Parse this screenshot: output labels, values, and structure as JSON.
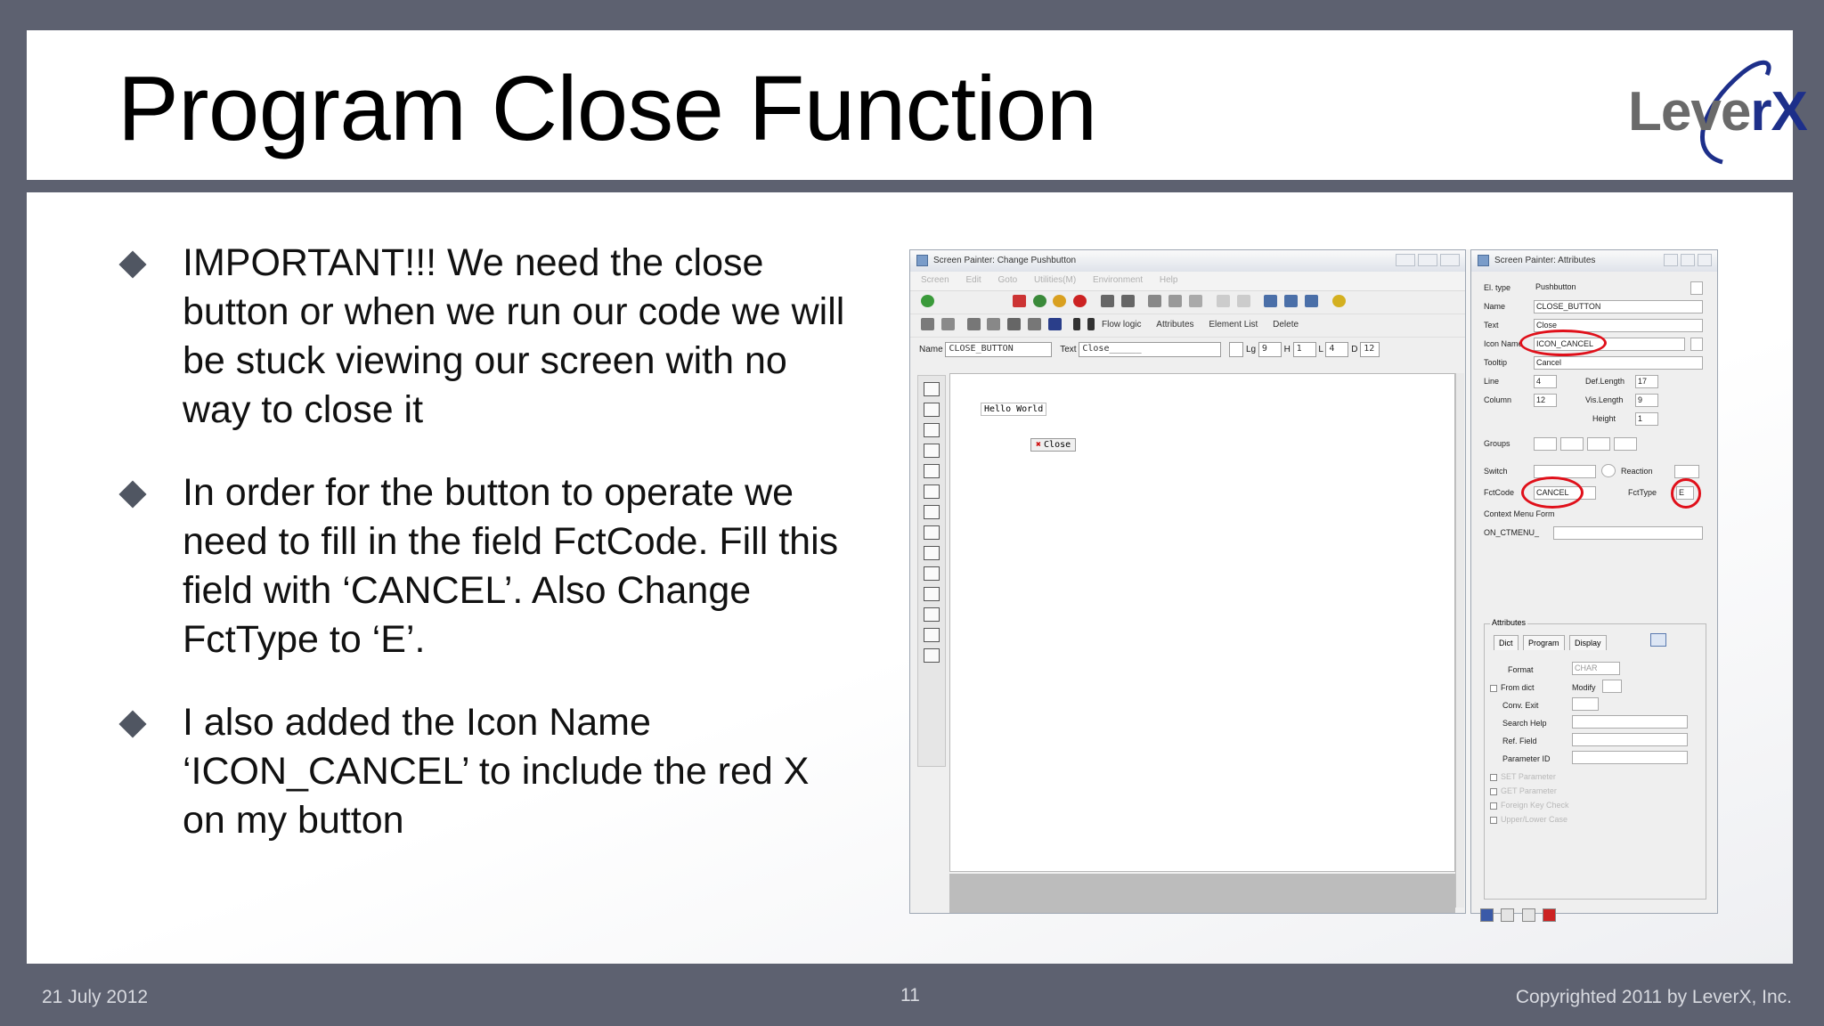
{
  "slide": {
    "title": "Program Close Function",
    "logo": {
      "text_main": "Leve",
      "text_accent": "rX",
      "accent_color": "#1d2f8a"
    },
    "bullets": [
      {
        "text": "IMPORTANT!!! We need the close button or when we run our code we will be stuck viewing our screen with no way to close it"
      },
      {
        "text": "In order for the button to operate we need to fill in the field FctCode. Fill this field with ‘CANCEL’. Also Change FctType to ‘E’."
      },
      {
        "text": "I also added the Icon Name ‘ICON_CANCEL’ to include the red X on my button"
      }
    ],
    "footer": {
      "date": "21 July 2012",
      "page": "11",
      "copyright": "Copyrighted 2011 by LeverX, Inc."
    }
  },
  "screenshot": {
    "left_window": {
      "title": "Screen Painter: Change Pushbutton",
      "menu": [
        "Screen",
        "Edit",
        "Goto",
        "Utilities(M)",
        "Environment",
        "Help"
      ],
      "toolbar_labels": [
        "Flow logic",
        "Attributes",
        "Element List",
        "Delete"
      ],
      "name_label": "Name",
      "name_value": "CLOSE_BUTTON",
      "text_label": "Text",
      "text_value": "Close______",
      "lg_label": "Lg",
      "lg_value": "9",
      "h_label": "H",
      "h_value": "1",
      "l_label": "L",
      "l_value": "4",
      "d_label": "D",
      "d_value": "12",
      "canvas_text": "Hello World",
      "canvas_button": "Close"
    },
    "right_window": {
      "title": "Screen Painter: Attributes",
      "fields": {
        "el_type_label": "El. type",
        "el_type_value": "Pushbutton",
        "name_label": "Name",
        "name_value": "CLOSE_BUTTON",
        "text_label": "Text",
        "text_value": "Close",
        "icon_label": "Icon Name",
        "icon_value": "ICON_CANCEL",
        "tooltip_label": "Tooltip",
        "tooltip_value": "Cancel",
        "line_label": "Line",
        "line_value": "4",
        "deflength_label": "Def.Length",
        "deflength_value": "17",
        "column_label": "Column",
        "column_value": "12",
        "vislength_label": "Vis.Length",
        "vislength_value": "9",
        "height_label": "Height",
        "height_value": "1",
        "groups_label": "Groups",
        "switch_label": "Switch",
        "reaction_label": "Reaction",
        "fctcode_label": "FctCode",
        "fctcode_value": "CANCEL",
        "fcttype_label": "FctType",
        "fcttype_value": "E",
        "context_label": "Context Menu Form",
        "context_value": "ON_CTMENU_"
      },
      "attributes_group": {
        "title": "Attributes",
        "tabs": [
          "Dict",
          "Program",
          "Display"
        ],
        "format_label": "Format",
        "format_value": "CHAR",
        "from_dict_label": "From dict",
        "modify_label": "Modify",
        "conv_exit_label": "Conv. Exit",
        "search_help_label": "Search Help",
        "ref_field_label": "Ref. Field",
        "param_id_label": "Parameter ID",
        "dim_checks": [
          "SET Parameter",
          "GET Parameter",
          "Foreign Key Check",
          "Upper/Lower Case"
        ]
      }
    }
  }
}
